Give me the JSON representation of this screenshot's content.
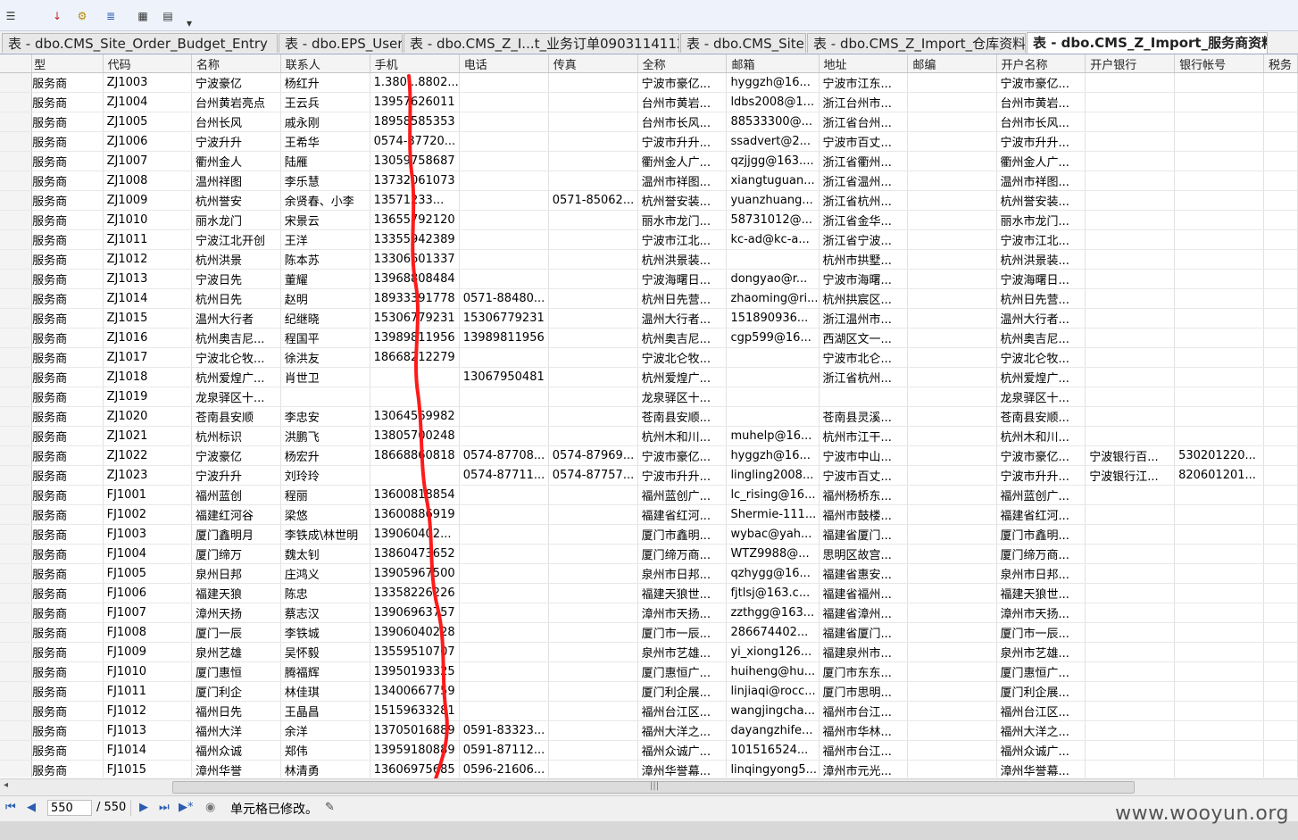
{
  "tabs": [
    {
      "label": "表 - dbo.CMS_Site_Order_Budget_Entry",
      "active": false
    },
    {
      "label": "表 - dbo.EPS_User",
      "active": false
    },
    {
      "label": "表 - dbo.CMS_Z_I...t_业务订单0903114112",
      "active": false
    },
    {
      "label": "表 - dbo.CMS_Site",
      "active": false
    },
    {
      "label": "表 - dbo.CMS_Z_Import_仓库资料",
      "active": false
    },
    {
      "label": "表 - dbo.CMS_Z_Import_服务商资料",
      "active": true
    }
  ],
  "columns": [
    "型",
    "代码",
    "名称",
    "联系人",
    "手机",
    "电话",
    "传真",
    "全称",
    "邮箱",
    "地址",
    "邮编",
    "开户名称",
    "开户银行",
    "银行帐号",
    "税务"
  ],
  "rows": [
    [
      "服务商",
      "ZJ1003",
      "宁波豪亿",
      "杨红升",
      "1.380...8802...",
      "",
      "",
      "宁波市豪亿...",
      "hyggzh@16...",
      "宁波市江东...",
      "",
      "宁波市豪亿...",
      "",
      ""
    ],
    [
      "服务商",
      "ZJ1004",
      "台州黄岩亮点",
      "王云兵",
      "13957626011",
      "",
      "",
      "台州市黄岩...",
      "ldbs2008@1...",
      "浙江台州市...",
      "",
      "台州市黄岩...",
      "",
      ""
    ],
    [
      "服务商",
      "ZJ1005",
      "台州长风",
      "戚永刚",
      "18958585353",
      "",
      "",
      "台州市长风...",
      "88533300@...",
      "浙江省台州...",
      "",
      "台州市长风...",
      "",
      ""
    ],
    [
      "服务商",
      "ZJ1006",
      "宁波升升",
      "王希华",
      "0574-87720...",
      "",
      "",
      "宁波市升升...",
      "ssadvert@2...",
      "宁波市百丈...",
      "",
      "宁波市升升...",
      "",
      ""
    ],
    [
      "服务商",
      "ZJ1007",
      "衢州金人",
      "陆雁",
      "13059758687",
      "",
      "",
      "衢州金人广...",
      "qzjjgg@163....",
      "浙江省衢州...",
      "",
      "衢州金人广...",
      "",
      ""
    ],
    [
      "服务商",
      "ZJ1008",
      "温州祥图",
      "李乐慧",
      "13732061073",
      "",
      "",
      "温州市祥图...",
      "xiangtuguan...",
      "浙江省温州...",
      "",
      "温州市祥图...",
      "",
      ""
    ],
    [
      "服务商",
      "ZJ1009",
      "杭州誉安",
      "余贤春、小李",
      "13571233...",
      "",
      "0571-85062...",
      "杭州誉安装...",
      "yuanzhuang...",
      "浙江省杭州...",
      "",
      "杭州誉安装...",
      "",
      ""
    ],
    [
      "服务商",
      "ZJ1010",
      "丽水龙门",
      "宋景云",
      "13655792120",
      "",
      "",
      "丽水市龙门...",
      "58731012@...",
      "浙江省金华...",
      "",
      "丽水市龙门...",
      "",
      ""
    ],
    [
      "服务商",
      "ZJ1011",
      "宁波江北开创",
      "王洋",
      "13355942389",
      "",
      "",
      "宁波市江北...",
      "kc-ad@kc-a...",
      "浙江省宁波...",
      "",
      "宁波市江北...",
      "",
      ""
    ],
    [
      "服务商",
      "ZJ1012",
      "杭州洪景",
      "陈本苏",
      "13306601337",
      "",
      "",
      "杭州洪景装...",
      "",
      "杭州市拱墅...",
      "",
      "杭州洪景装...",
      "",
      ""
    ],
    [
      "服务商",
      "ZJ1013",
      "宁波日先",
      "董耀",
      "13968808484",
      "",
      "",
      "宁波海曙日...",
      "dongyao@r...",
      "宁波市海曙...",
      "",
      "宁波海曙日...",
      "",
      ""
    ],
    [
      "服务商",
      "ZJ1014",
      "杭州日先",
      "赵明",
      "18933391778",
      "0571-88480...",
      "",
      "杭州日先营...",
      "zhaoming@ri...",
      "杭州拱宸区...",
      "",
      "杭州日先营...",
      "",
      ""
    ],
    [
      "服务商",
      "ZJ1015",
      "温州大行者",
      "纪继晓",
      "15306779231",
      "15306779231",
      "",
      "温州大行者...",
      "151890936...",
      "浙江温州市...",
      "",
      "温州大行者...",
      "",
      ""
    ],
    [
      "服务商",
      "ZJ1016",
      "杭州奥吉尼...",
      "程国平",
      "13989811956",
      "13989811956",
      "",
      "杭州奥吉尼...",
      "cgp599@16...",
      "西湖区文一...",
      "",
      "杭州奥吉尼...",
      "",
      ""
    ],
    [
      "服务商",
      "ZJ1017",
      "宁波北仑牧...",
      "徐洪友",
      "18668212279",
      "",
      "",
      "宁波北仑牧...",
      "",
      "宁波市北仑...",
      "",
      "宁波北仑牧...",
      "",
      ""
    ],
    [
      "服务商",
      "ZJ1018",
      "杭州爱煌广...",
      "肖世卫",
      "",
      "13067950481",
      "",
      "杭州爱煌广...",
      "",
      "浙江省杭州...",
      "",
      "杭州爱煌广...",
      "",
      ""
    ],
    [
      "服务商",
      "ZJ1019",
      "龙泉驿区十...",
      "",
      "",
      "",
      "",
      "龙泉驿区十...",
      "",
      "",
      "",
      "龙泉驿区十...",
      "",
      ""
    ],
    [
      "服务商",
      "ZJ1020",
      "苍南县安顺",
      "李忠安",
      "13064569982",
      "",
      "",
      "苍南县安顺...",
      "",
      "苍南县灵溪...",
      "",
      "苍南县安顺...",
      "",
      ""
    ],
    [
      "服务商",
      "ZJ1021",
      "杭州标识",
      "洪鹏飞",
      "13805700248",
      "",
      "",
      "杭州木和川...",
      "muhelp@16...",
      "杭州市江干...",
      "",
      "杭州木和川...",
      "",
      ""
    ],
    [
      "服务商",
      "ZJ1022",
      "宁波豪亿",
      "杨宏升",
      "18668860818",
      "0574-87708...",
      "0574-87969...",
      "宁波市豪亿...",
      "hyggzh@16...",
      "宁波市中山...",
      "",
      "宁波市豪亿...",
      "宁波银行百...",
      "530201220..."
    ],
    [
      "服务商",
      "ZJ1023",
      "宁波升升",
      "刘玲玲",
      "",
      "0574-87711...",
      "0574-87757...",
      "宁波市升升...",
      "lingling2008...",
      "宁波市百丈...",
      "",
      "宁波市升升...",
      "宁波银行江...",
      "820601201..."
    ],
    [
      "服务商",
      "FJ1001",
      "福州蓝创",
      "程丽",
      "13600818854",
      "",
      "",
      "福州蓝创广...",
      "lc_rising@16...",
      "福州杨桥东...",
      "",
      "福州蓝创广...",
      "",
      ""
    ],
    [
      "服务商",
      "FJ1002",
      "福建红河谷",
      "梁悠",
      "13600886919",
      "",
      "",
      "福建省红河...",
      "Shermie-111...",
      "福州市鼓楼...",
      "",
      "福建省红河...",
      "",
      ""
    ],
    [
      "服务商",
      "FJ1003",
      "厦门鑫明月",
      "李铁成\\林世明",
      "139060402...",
      "",
      "",
      "厦门市鑫明...",
      "wybac@yah...",
      "福建省厦门...",
      "",
      "厦门市鑫明...",
      "",
      ""
    ],
    [
      "服务商",
      "FJ1004",
      "厦门缔万",
      "魏太钊",
      "13860473652",
      "",
      "",
      "厦门缔万商...",
      "WTZ9988@...",
      "思明区故宫...",
      "",
      "厦门缔万商...",
      "",
      ""
    ],
    [
      "服务商",
      "FJ1005",
      "泉州日邦",
      "庄鸿义",
      "13905967500",
      "",
      "",
      "泉州市日邦...",
      "qzhygg@16...",
      "福建省惠安...",
      "",
      "泉州市日邦...",
      "",
      ""
    ],
    [
      "服务商",
      "FJ1006",
      "福建天狼",
      "陈忠",
      "13358226226",
      "",
      "",
      "福建天狼世...",
      "fjtlsj@163.c...",
      "福建省福州...",
      "",
      "福建天狼世...",
      "",
      ""
    ],
    [
      "服务商",
      "FJ1007",
      "漳州天扬",
      "蔡志汉",
      "13906963757",
      "",
      "",
      "漳州市天扬...",
      "zzthgg@163...",
      "福建省漳州...",
      "",
      "漳州市天扬...",
      "",
      ""
    ],
    [
      "服务商",
      "FJ1008",
      "厦门一辰",
      "李铁城",
      "13906040228",
      "",
      "",
      "厦门市一辰...",
      "286674402...",
      "福建省厦门...",
      "",
      "厦门市一辰...",
      "",
      ""
    ],
    [
      "服务商",
      "FJ1009",
      "泉州艺雄",
      "吴怀毅",
      "13559510707",
      "",
      "",
      "泉州市艺雄...",
      "yi_xiong126...",
      "福建泉州市...",
      "",
      "泉州市艺雄...",
      "",
      ""
    ],
    [
      "服务商",
      "FJ1010",
      "厦门惠恒",
      "腾福辉",
      "13950193325",
      "",
      "",
      "厦门惠恒广...",
      "huiheng@hu...",
      "厦门市东东...",
      "",
      "厦门惠恒广...",
      "",
      ""
    ],
    [
      "服务商",
      "FJ1011",
      "厦门利企",
      "林佳琪",
      "13400667759",
      "",
      "",
      "厦门利企展...",
      "linjiaqi@rocc...",
      "厦门市思明...",
      "",
      "厦门利企展...",
      "",
      ""
    ],
    [
      "服务商",
      "FJ1012",
      "福州日先",
      "王晶昌",
      "15159633281",
      "",
      "",
      "福州台江区...",
      "wangjingcha...",
      "福州市台江...",
      "",
      "福州台江区...",
      "",
      ""
    ],
    [
      "服务商",
      "FJ1013",
      "福州大洋",
      "余洋",
      "13705016889",
      "0591-83323...",
      "",
      "福州大洋之...",
      "dayangzhife...",
      "福州市华林...",
      "",
      "福州大洋之...",
      "",
      ""
    ],
    [
      "服务商",
      "FJ1014",
      "福州众诚",
      "郑伟",
      "13959180889",
      "0591-87112...",
      "",
      "福州众诚广...",
      "101516524...",
      "福州市台江...",
      "",
      "福州众诚广...",
      "",
      ""
    ],
    [
      "服务商",
      "FJ1015",
      "漳州华誉",
      "林清勇",
      "13606975685",
      "0596-21606...",
      "",
      "漳州华誉幕...",
      "linqingyong5...",
      "漳州市元光...",
      "",
      "漳州华誉幕...",
      "",
      ""
    ]
  ],
  "status": {
    "current_page": "550",
    "total_pages": "/ 550",
    "message": "单元格已修改。"
  },
  "watermark": "www.wooyun.org",
  "colors": {
    "annotation_line": "#ff1a1a",
    "active_tab": "#ffffff",
    "nav": "#2a5db0"
  }
}
